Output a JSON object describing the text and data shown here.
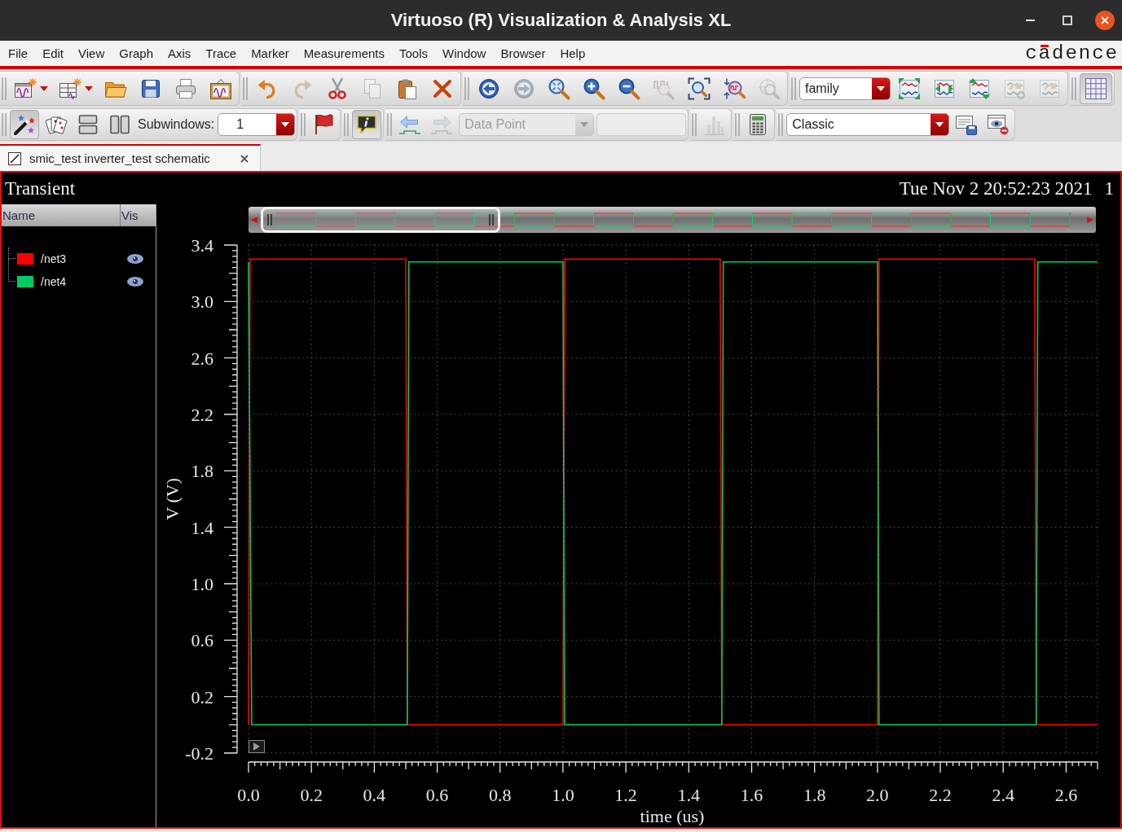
{
  "window": {
    "title": "Virtuoso (R) Visualization & Analysis XL"
  },
  "menu_bar": {
    "items": [
      {
        "label": "File"
      },
      {
        "label": "Edit"
      },
      {
        "label": "View"
      },
      {
        "label": "Graph"
      },
      {
        "label": "Axis"
      },
      {
        "label": "Trace"
      },
      {
        "label": "Marker"
      },
      {
        "label": "Measurements"
      },
      {
        "label": "Tools"
      },
      {
        "label": "Window"
      },
      {
        "label": "Browser"
      },
      {
        "label": "Help"
      }
    ],
    "logo": "cadence"
  },
  "toolbar_rows": [
    {
      "groups": [
        {
          "items": [
            {
              "kind": "icon_menu",
              "disabled": false,
              "pressed": false
            },
            {
              "kind": "icon_menu",
              "disabled": false,
              "pressed": false
            },
            {
              "kind": "icon",
              "disabled": false,
              "pressed": false
            },
            {
              "kind": "icon",
              "disabled": false,
              "pressed": false
            },
            {
              "kind": "icon",
              "disabled": false,
              "pressed": false
            },
            {
              "kind": "icon",
              "disabled": false,
              "pressed": false
            }
          ]
        },
        {
          "items": [
            {
              "kind": "icon",
              "disabled": false,
              "pressed": false
            },
            {
              "kind": "icon",
              "disabled": true,
              "pressed": false
            },
            {
              "kind": "icon",
              "disabled": false,
              "pressed": false
            },
            {
              "kind": "icon",
              "disabled": true,
              "pressed": false
            },
            {
              "kind": "icon",
              "disabled": false,
              "pressed": false
            },
            {
              "kind": "icon",
              "disabled": false,
              "pressed": false
            }
          ]
        },
        {
          "items": [
            {
              "kind": "icon",
              "disabled": false,
              "pressed": false
            },
            {
              "kind": "icon",
              "disabled": true,
              "pressed": false
            },
            {
              "kind": "icon",
              "disabled": false,
              "pressed": false
            },
            {
              "kind": "icon",
              "disabled": false,
              "pressed": false
            },
            {
              "kind": "icon",
              "disabled": false,
              "pressed": false
            },
            {
              "kind": "icon",
              "disabled": true,
              "pressed": false
            },
            {
              "kind": "icon",
              "disabled": false,
              "pressed": false
            },
            {
              "kind": "icon",
              "disabled": false,
              "pressed": false
            },
            {
              "kind": "icon",
              "disabled": true,
              "pressed": false
            }
          ]
        },
        {
          "items": [
            {
              "kind": "dropdown",
              "value": "family",
              "disabled": false
            },
            {
              "kind": "icon",
              "disabled": false,
              "pressed": false
            },
            {
              "kind": "icon",
              "disabled": false,
              "pressed": false
            },
            {
              "kind": "icon",
              "disabled": false,
              "pressed": false
            },
            {
              "kind": "icon",
              "disabled": true,
              "pressed": false
            },
            {
              "kind": "icon",
              "disabled": true,
              "pressed": false
            }
          ]
        },
        {
          "items": [
            {
              "kind": "icon",
              "disabled": false,
              "pressed": true
            }
          ]
        }
      ]
    },
    {
      "groups": [
        {
          "items": [
            {
              "kind": "icon",
              "disabled": false,
              "pressed": true
            },
            {
              "kind": "icon",
              "disabled": false,
              "pressed": false
            },
            {
              "kind": "icon",
              "disabled": false,
              "pressed": false
            },
            {
              "kind": "icon",
              "disabled": false,
              "pressed": false
            },
            {
              "kind": "label",
              "text": "Subwindows:",
              "disabled": false
            },
            {
              "kind": "spinbox",
              "value": "1",
              "disabled": false
            }
          ]
        },
        {
          "items": [
            {
              "kind": "icon",
              "disabled": false,
              "pressed": false
            }
          ]
        },
        {
          "items": [
            {
              "kind": "icon",
              "disabled": false,
              "pressed": true
            }
          ]
        },
        {
          "items": [
            {
              "kind": "icon",
              "disabled": false,
              "pressed": false
            },
            {
              "kind": "icon",
              "disabled": true,
              "pressed": false
            },
            {
              "kind": "dropdown",
              "value": "Data Point",
              "disabled": true
            },
            {
              "kind": "field",
              "disabled": true
            }
          ]
        },
        {
          "items": [
            {
              "kind": "icon",
              "disabled": true,
              "pressed": false
            }
          ]
        },
        {
          "items": [
            {
              "kind": "icon",
              "disabled": false,
              "pressed": false
            }
          ]
        },
        {
          "items": [
            {
              "kind": "dropdown",
              "value": "Classic",
              "disabled": false
            },
            {
              "kind": "icon",
              "disabled": false,
              "pressed": false
            },
            {
              "kind": "icon",
              "disabled": false,
              "pressed": false
            }
          ]
        }
      ]
    }
  ],
  "tabs": [
    {
      "label": "smic_test inverter_test schematic",
      "selected": true
    }
  ],
  "plot_window": {
    "title": "Transient",
    "timestamp": "Tue Nov 2 20:52:23 2021",
    "subwindow": "1",
    "trace_list": {
      "columns": [
        "Name",
        "Vis"
      ],
      "traces": [
        {
          "name": "/net3",
          "color": "#ff0000",
          "visible": true
        },
        {
          "name": "/net4",
          "color": "#00cc66",
          "visible": true
        }
      ]
    },
    "chart_data": [
      {
        "type": "line",
        "xlabel": "time (us)",
        "ylabel": "V (V)",
        "xlim": [
          0,
          2.7
        ],
        "ylim": [
          -0.2,
          3.4
        ],
        "xticks": [
          {
            "value": 0,
            "label": "0.0"
          },
          0.2,
          0.4,
          0.6,
          0.8,
          {
            "value": 1,
            "label": "1.0"
          },
          1.2,
          1.4,
          1.6,
          1.8,
          {
            "value": 2,
            "label": "2.0"
          },
          2.2,
          2.4,
          2.6
        ],
        "yticks": [
          -0.2,
          0.2,
          0.6,
          {
            "value": 1,
            "label": "1.0"
          },
          1.4,
          1.8,
          2.2,
          2.6,
          {
            "value": 3,
            "label": "3.0"
          },
          3.4
        ],
        "grid": true,
        "series": [
          {
            "color": "#ff0000",
            "x": [
              0,
              0.005,
              0.5,
              0.505,
              1.0,
              1.005,
              1.5,
              1.505,
              2.0,
              2.005,
              2.5,
              2.505,
              2.7
            ],
            "values": [
              0,
              3.3,
              3.3,
              0,
              0,
              3.3,
              3.3,
              0,
              0,
              3.3,
              3.3,
              0,
              0
            ]
          },
          {
            "color": "#00cc66",
            "x": [
              0,
              0.01,
              0.505,
              0.51,
              1.0,
              1.005,
              1.505,
              1.51,
              2.0,
              2.005,
              2.505,
              2.51,
              2.7
            ],
            "values": [
              3.28,
              0,
              0,
              3.28,
              3.28,
              0,
              0,
              3.28,
              3.28,
              0,
              0,
              3.28,
              3.28
            ]
          }
        ]
      }
    ]
  }
}
